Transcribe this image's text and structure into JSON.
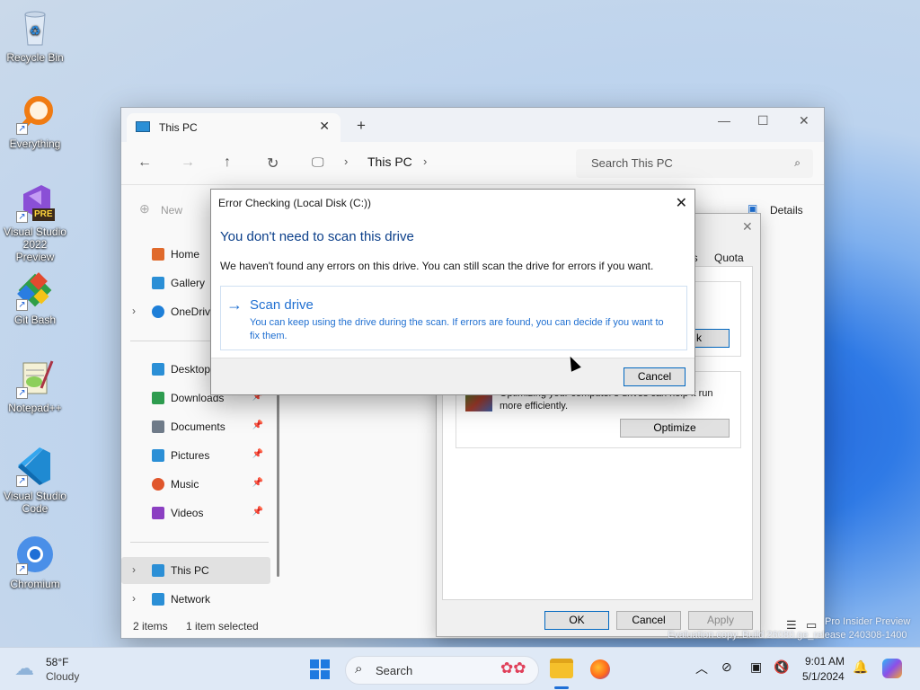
{
  "desktop": {
    "icons": [
      {
        "label": "Recycle Bin",
        "icon": "recycle-bin-icon"
      },
      {
        "label": "Everything",
        "icon": "magnifier-icon"
      },
      {
        "label": "Visual Studio 2022 Preview",
        "icon": "visual-studio-icon"
      },
      {
        "label": "Git Bash",
        "icon": "git-icon"
      },
      {
        "label": "Notepad++",
        "icon": "notepad-icon"
      },
      {
        "label": "Visual Studio Code",
        "icon": "vscode-icon"
      },
      {
        "label": "Chromium",
        "icon": "chromium-icon"
      }
    ],
    "vs_badge": "PRE"
  },
  "explorer": {
    "tab_title": "This PC",
    "breadcrumb": "This PC",
    "search_placeholder": "Search This PC",
    "new_label": "New",
    "details_label": "Details",
    "sidebar": [
      {
        "label": "Home",
        "icon": "home-icon",
        "color": "#e06a2c"
      },
      {
        "label": "Gallery",
        "icon": "gallery-icon",
        "color": "#2b8fd6"
      },
      {
        "label": "OneDrive",
        "icon": "cloud-icon",
        "color": "#1e7fd8"
      },
      {
        "label": "Desktop",
        "icon": "desktop-icon",
        "color": "#2b8fd6"
      },
      {
        "label": "Downloads",
        "icon": "download-icon",
        "color": "#2e9c4f"
      },
      {
        "label": "Documents",
        "icon": "documents-icon",
        "color": "#6f7b89"
      },
      {
        "label": "Pictures",
        "icon": "pictures-icon",
        "color": "#2b8fd6"
      },
      {
        "label": "Music",
        "icon": "music-icon",
        "color": "#e0562c"
      },
      {
        "label": "Videos",
        "icon": "videos-icon",
        "color": "#8b3fc2"
      },
      {
        "label": "This PC",
        "icon": "pc-icon",
        "color": "#2b8fd6"
      },
      {
        "label": "Network",
        "icon": "network-icon",
        "color": "#2b8fd6"
      }
    ],
    "status_items": "2 items",
    "status_selected": "1 item selected"
  },
  "properties": {
    "tab_partial_1": "ns",
    "tab_quota": "Quota",
    "check_button_partial": "k",
    "optimize_text_partial": "Optimizing your computer's drives can help it run",
    "optimize_text_2": "more efficiently.",
    "optimize_button": "Optimize",
    "ok": "OK",
    "cancel": "Cancel",
    "apply": "Apply"
  },
  "error_dialog": {
    "title": "Error Checking (Local Disk (C:))",
    "heading": "You don't need to scan this drive",
    "message": "We haven't found any errors on this drive. You can still scan the drive for errors if you want.",
    "scan_title": "Scan drive",
    "scan_desc": "You can keep using the drive during the scan. If errors are found, you can decide if you want to fix them.",
    "cancel": "Cancel"
  },
  "watermark": {
    "line1": "Pro Insider Preview",
    "line2": "Evaluation copy. Build 26080.ge_release 240308-1400"
  },
  "taskbar": {
    "weather_temp": "58°F",
    "weather_desc": "Cloudy",
    "search_label": "Search",
    "time": "9:01 AM",
    "date": "5/1/2024"
  }
}
